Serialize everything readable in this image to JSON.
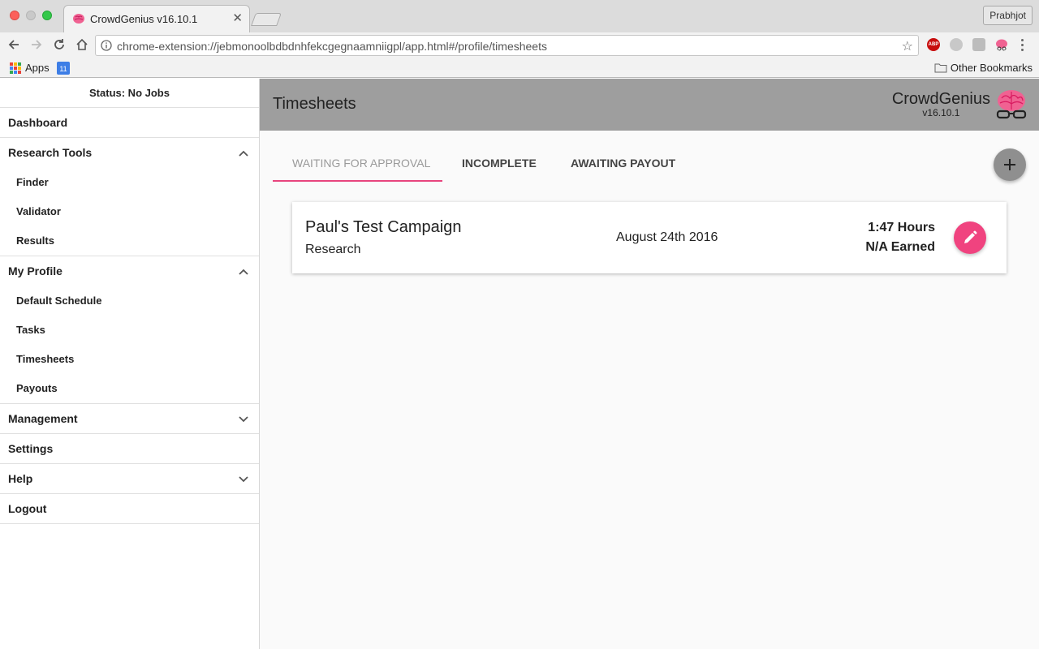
{
  "browser": {
    "tab_title": "CrowdGenius v16.10.1",
    "tab_close": "✕",
    "profile_name": "Prabhjot",
    "url": "chrome-extension://jebmonoolbdbdnhfekcgegnaamniigpl/app.html#/profile/timesheets",
    "extensions": [
      "abp-icon",
      "m-extension-icon",
      "k-extension-icon",
      "crowdgenius-brain-icon"
    ],
    "bookmarks": {
      "apps_label": "Apps",
      "calendar_day": "11",
      "other_label": "Other Bookmarks"
    }
  },
  "sidebar": {
    "status": "Status: No Jobs",
    "dashboard": "Dashboard",
    "research_tools": {
      "label": "Research Tools",
      "items": [
        "Finder",
        "Validator",
        "Results"
      ]
    },
    "my_profile": {
      "label": "My Profile",
      "items": [
        "Default Schedule",
        "Tasks",
        "Timesheets",
        "Payouts"
      ]
    },
    "management": "Management",
    "settings": "Settings",
    "help": "Help",
    "logout": "Logout"
  },
  "header": {
    "title": "Timesheets",
    "brand_name": "CrowdGenius",
    "brand_version": "v16.10.1"
  },
  "tabs": {
    "active": "WAITING FOR APPROVAL",
    "items": [
      "WAITING FOR APPROVAL",
      "INCOMPLETE",
      "AWAITING PAYOUT"
    ]
  },
  "timesheet": {
    "campaign": "Paul's Test Campaign",
    "type": "Research",
    "date": "August 24th 2016",
    "hours": "1:47 Hours",
    "earned": "N/A Earned"
  },
  "colors": {
    "accent": "#f0437f",
    "tab_underline": "#e8457e",
    "header_bg": "#9e9e9e",
    "add_button": "#8f8f8f",
    "logo_pink": "#f06292"
  }
}
